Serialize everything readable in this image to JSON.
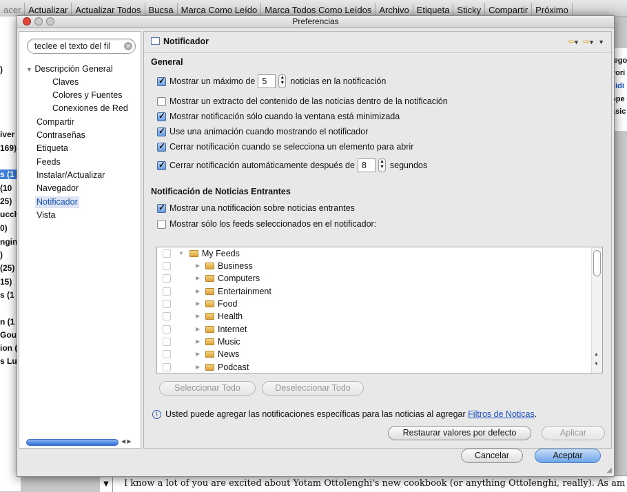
{
  "background": {
    "toolbar": [
      "acer",
      "Actualizar",
      "Actualizar Todos",
      "Bucsa",
      "Marca Como Leído",
      "Marca Todos Como Leídos",
      "Archivo",
      "Etiqueta",
      "Sticky",
      "Compartir",
      "Próximo"
    ],
    "left_fragments": [
      ")",
      "iver",
      "169)",
      "s (1",
      "(10",
      "25)",
      "ucch",
      "0)",
      "ngin",
      ")",
      "(25)",
      "15)",
      "s (1",
      "n (1",
      "Gou",
      "ion (",
      "s Lu"
    ],
    "right_fragments": [
      "tego",
      "vori",
      "eidi",
      "ope",
      "asic"
    ],
    "bottom_text": "I know a lot of you are excited about Yotam Ottolenghi's new cookbook (or anything Ottolenghi, really). As am I."
  },
  "dialog": {
    "title": "Preferencias",
    "filter_placeholder": "teclee el texto del fil",
    "tree": [
      {
        "label": "Descripción General",
        "level": 0,
        "expanded": true
      },
      {
        "label": "Claves",
        "level": 1
      },
      {
        "label": "Colores y Fuentes",
        "level": 1
      },
      {
        "label": "Conexiones de Red",
        "level": 1
      },
      {
        "label": "Compartir",
        "level": 0
      },
      {
        "label": "Contraseñas",
        "level": 0
      },
      {
        "label": "Etiqueta",
        "level": 0
      },
      {
        "label": "Feeds",
        "level": 0
      },
      {
        "label": "Instalar/Actualizar",
        "level": 0
      },
      {
        "label": "Navegador",
        "level": 0
      },
      {
        "label": "Notificador",
        "level": 0,
        "selected": true
      },
      {
        "label": "Vista",
        "level": 0
      }
    ],
    "page_title": "Notificador",
    "general_title": "General",
    "opt_max_pre": "Mostrar un máximo de",
    "opt_max_value": "5",
    "opt_max_post": "noticias en la notificación",
    "opt_excerpt": "Mostrar un extracto del contenido de las noticias dentro de la notificación",
    "opt_minimized": "Mostrar notificación sólo cuando la ventana está minimizada",
    "opt_animation": "Use una animación cuando mostrando el notificador",
    "opt_close_open": "Cerrar notificación cuando se selecciona un elemento para abrir",
    "opt_autoclose_pre": "Cerrar notificación automáticamente después de",
    "opt_autoclose_value": "8",
    "opt_autoclose_post": "segundos",
    "incoming_title": "Notificación de Noticias Entrantes",
    "opt_incoming": "Mostrar una notificación sobre noticias entrantes",
    "opt_selected_feeds": "Mostrar sólo los feeds seleccionados en el notificador:",
    "checks": {
      "max": true,
      "excerpt": false,
      "minimized": true,
      "animation": true,
      "close_open": true,
      "autoclose": true,
      "incoming": true,
      "selected_feeds": false
    },
    "feeds_root": "My Feeds",
    "feeds": [
      "Business",
      "Computers",
      "Entertainment",
      "Food",
      "Health",
      "Internet",
      "Music",
      "News",
      "Podcast"
    ],
    "select_all": "Seleccionar Todo",
    "deselect_all": "Deseleccionar Todo",
    "info_text": "Usted puede agregar las notificaciones específicas para las noticias al agregar",
    "info_link": "Filtros de Noticas",
    "info_end": ".",
    "restore": "Restaurar valores por defecto",
    "apply": "Aplicar",
    "cancel": "Cancelar",
    "accept": "Aceptar"
  }
}
